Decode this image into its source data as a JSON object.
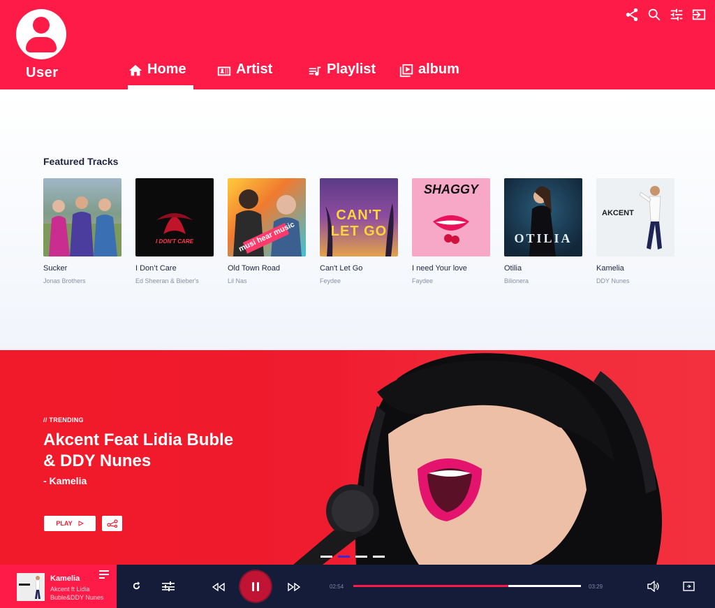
{
  "header": {
    "user_label": "User",
    "nav": [
      {
        "label": "Home",
        "icon": "home-icon"
      },
      {
        "label": "Artist",
        "icon": "artist-icon"
      },
      {
        "label": "Playlist",
        "icon": "playlist-icon"
      },
      {
        "label": "album",
        "icon": "album-icon"
      }
    ],
    "actions": [
      "share-icon",
      "search-icon",
      "equalizer-icon",
      "logout-icon"
    ],
    "accent_color": "#fe1b48"
  },
  "featured": {
    "title": "Featured Tracks",
    "tracks": [
      {
        "name": "Sucker",
        "artist": "Jonas Brothers"
      },
      {
        "name": "I Don’t Care",
        "artist": "Ed Sheeran & Bieber's",
        "cover_text": "I DON'T CARE"
      },
      {
        "name": "Old Town Road",
        "artist": "Lil Nas",
        "cover_text": "musi hear music"
      },
      {
        "name": "Can't Let Go",
        "artist": "Feydee",
        "cover_text": "CAN'T LET GO"
      },
      {
        "name": "I need Your love",
        "artist": "Faydee",
        "cover_text": "SHAGGY"
      },
      {
        "name": "Otilia",
        "artist": "Bilionera",
        "cover_text": "OTILIA"
      },
      {
        "name": "Kamelia",
        "artist": "DDY Nunes",
        "cover_text": "AKCENT"
      }
    ]
  },
  "hero": {
    "trend": "// TRENDING",
    "title": "Akcent Feat Lidia Buble & DDY Nunes",
    "subtitle": "- Kamelia",
    "play_label": "PLAY",
    "slides": 4,
    "active_slide": 2,
    "background_color": "#ef1b2e"
  },
  "player": {
    "title": "Kamelia",
    "artist": "Akcent ft Lidia Buble&DDY Nunes",
    "current_time": "02:54",
    "total_time": "03:29",
    "progress": 0.68,
    "background_color": "#141c3a"
  }
}
